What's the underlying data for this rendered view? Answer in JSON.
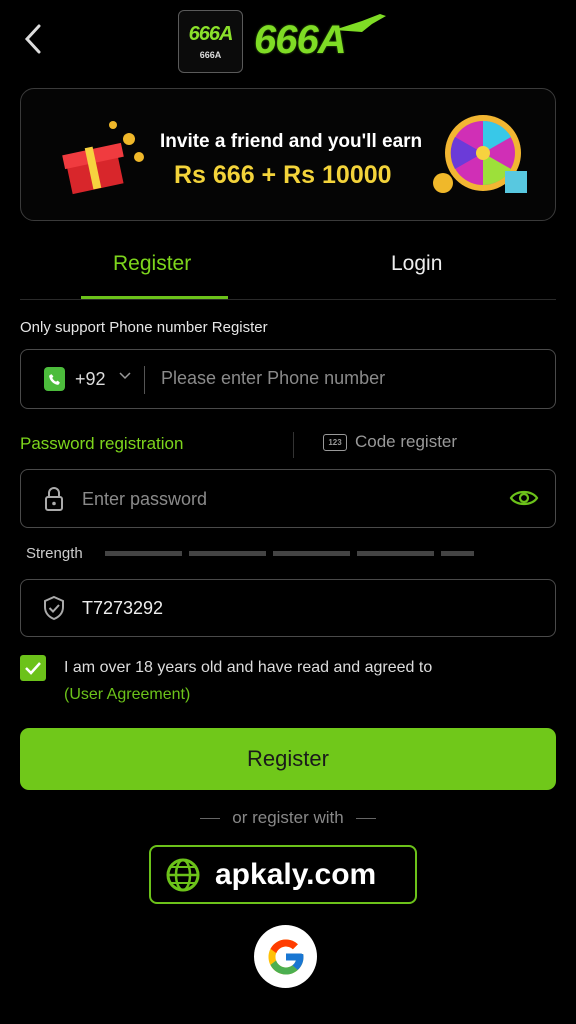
{
  "brand": {
    "name": "666A",
    "badge_small": "666A",
    "accent": "#6cc21a"
  },
  "icons": {
    "back": "chevron-left-icon",
    "phone": "phone-icon",
    "lock": "lock-icon",
    "eye": "eye-icon",
    "shield": "shield-check-icon",
    "globe": "globe-icon",
    "google": "google-icon"
  },
  "banner": {
    "line1": "Invite a friend and you'll earn",
    "line2": "Rs 666 + Rs 10000"
  },
  "tabs": {
    "register": "Register",
    "login": "Login",
    "active": "register"
  },
  "form": {
    "hint": "Only support Phone number Register",
    "country_code": "+92",
    "phone_placeholder": "Please enter Phone number",
    "mode_password": "Password registration",
    "mode_code_badge": "123",
    "mode_code": "Code register",
    "password_placeholder": "Enter password",
    "strength_label": "Strength",
    "invite_code": "T7273292",
    "agreement_checked": true,
    "agreement_text": "I am over 18 years old and have read and agreed to",
    "agreement_link": "(User Agreement)",
    "submit": "Register"
  },
  "social": {
    "or_text": "or register with",
    "watermark": "apkaly.com"
  }
}
